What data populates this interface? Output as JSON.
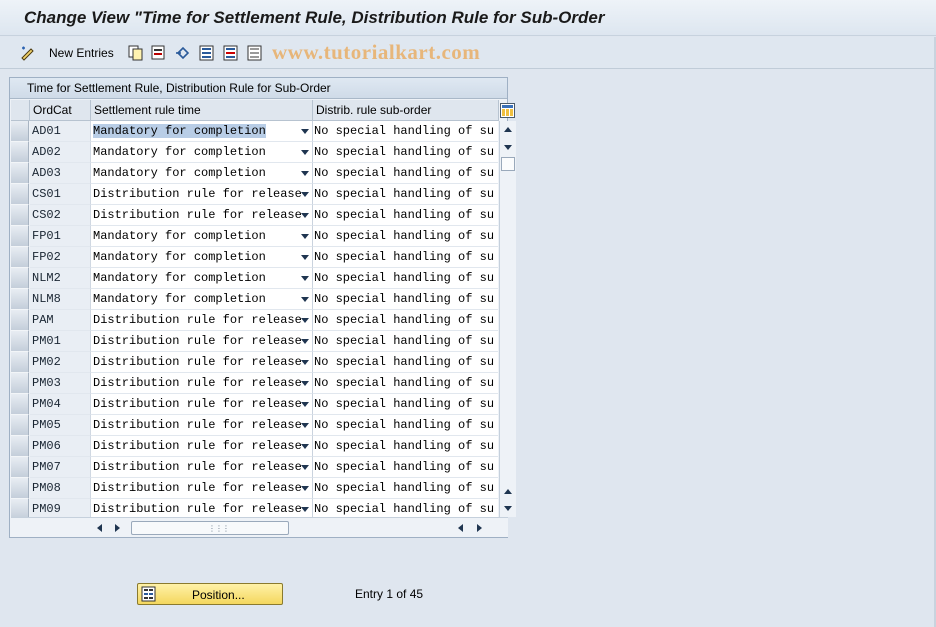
{
  "title": "Change View \"Time for Settlement Rule, Distribution Rule for Sub-Order",
  "toolbar": {
    "new_entries_label": "New Entries",
    "icons": [
      "edit-pencil-icon",
      "copy-icon",
      "delete-icon",
      "undo-icon",
      "select-all-icon",
      "select-block-icon",
      "deselect-all-icon"
    ]
  },
  "watermark": "www.tutorialkart.com",
  "table": {
    "title": "Time for Settlement Rule, Distribution Rule for Sub-Order",
    "columns": [
      "OrdCat",
      "Settlement rule time",
      "Distrib. rule sub-order"
    ],
    "rows": [
      {
        "ordcat": "AD01",
        "settlement": "Mandatory for completion",
        "distrib": "No special handling of su"
      },
      {
        "ordcat": "AD02",
        "settlement": "Mandatory for completion",
        "distrib": "No special handling of su"
      },
      {
        "ordcat": "AD03",
        "settlement": "Mandatory for completion",
        "distrib": "No special handling of su"
      },
      {
        "ordcat": "CS01",
        "settlement": "Distribution rule for release",
        "distrib": "No special handling of su"
      },
      {
        "ordcat": "CS02",
        "settlement": "Distribution rule for release",
        "distrib": "No special handling of su"
      },
      {
        "ordcat": "FP01",
        "settlement": "Mandatory for completion",
        "distrib": "No special handling of su"
      },
      {
        "ordcat": "FP02",
        "settlement": "Mandatory for completion",
        "distrib": "No special handling of su"
      },
      {
        "ordcat": "NLM2",
        "settlement": "Mandatory for completion",
        "distrib": "No special handling of su"
      },
      {
        "ordcat": "NLM8",
        "settlement": "Mandatory for completion",
        "distrib": "No special handling of su"
      },
      {
        "ordcat": "PAM",
        "settlement": "Distribution rule for release",
        "distrib": "No special handling of su"
      },
      {
        "ordcat": "PM01",
        "settlement": "Distribution rule for release",
        "distrib": "No special handling of su"
      },
      {
        "ordcat": "PM02",
        "settlement": "Distribution rule for release",
        "distrib": "No special handling of su"
      },
      {
        "ordcat": "PM03",
        "settlement": "Distribution rule for release",
        "distrib": "No special handling of su"
      },
      {
        "ordcat": "PM04",
        "settlement": "Distribution rule for release",
        "distrib": "No special handling of su"
      },
      {
        "ordcat": "PM05",
        "settlement": "Distribution rule for release",
        "distrib": "No special handling of su"
      },
      {
        "ordcat": "PM06",
        "settlement": "Distribution rule for release",
        "distrib": "No special handling of su"
      },
      {
        "ordcat": "PM07",
        "settlement": "Distribution rule for release",
        "distrib": "No special handling of su"
      },
      {
        "ordcat": "PM08",
        "settlement": "Distribution rule for release",
        "distrib": "No special handling of su"
      },
      {
        "ordcat": "PM09",
        "settlement": "Distribution rule for release",
        "distrib": "No special handling of su"
      }
    ],
    "selected_row": 0
  },
  "footer": {
    "position_label": "Position...",
    "entry_text": "Entry 1 of 45"
  },
  "colors": {
    "background": "#dfe6ef",
    "selection": "#b8cde6",
    "position_button": "#f4d75e",
    "watermark": "#e7b67a"
  }
}
